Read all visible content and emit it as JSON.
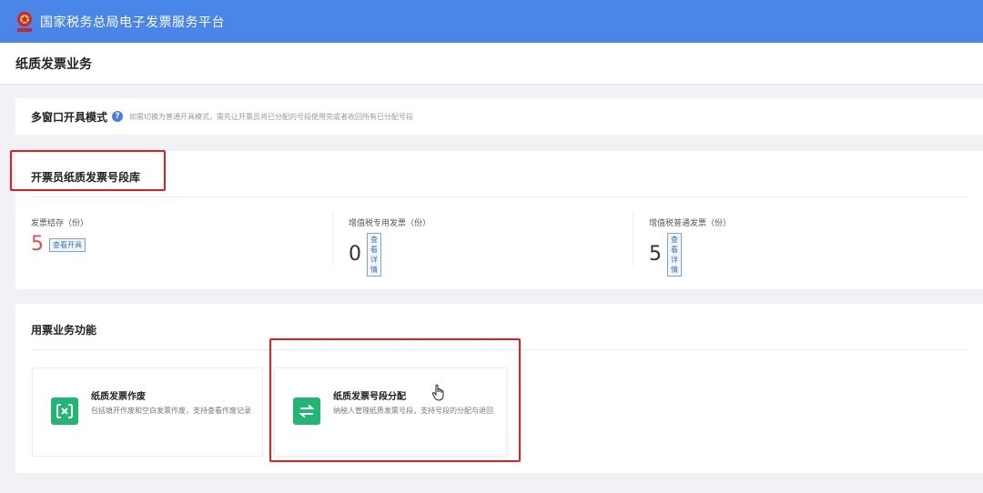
{
  "topbar": {
    "title": "国家税务总局电子发票服务平台",
    "brand_color": "#4a86e8"
  },
  "page": {
    "title": "纸质发票业务"
  },
  "mode": {
    "title": "多窗口开具模式",
    "help_icon_text": "?",
    "description": "如需切换为普通开具模式，需先让开票员将已分配的号段使用完或者收回所有已分配号段"
  },
  "library": {
    "title": "开票员纸质发票号段库",
    "stats": [
      {
        "label": "发票结存（份）",
        "value": "5",
        "button": "查看开具",
        "value_color": "#d9534f"
      },
      {
        "label": "增值税专用发票（份）",
        "value": "0",
        "button": "查看详情"
      },
      {
        "label": "增值税普通发票（份）",
        "value": "5",
        "button": "查看详情"
      }
    ]
  },
  "functions": {
    "title": "用票业务功能",
    "tiles": [
      {
        "name": "纸质发票作废",
        "description": "包括填开作废和空白发票作废，支持查看作废记录",
        "icon": "void-invoice-icon"
      },
      {
        "name": "纸质发票号段分配",
        "description": "纳税人管理纸质发票号段，支持号段的分配与退回",
        "icon": "swap-arrows-icon"
      }
    ]
  },
  "colors": {
    "accent_green": "#22b573",
    "highlight_red": "#e02020"
  }
}
